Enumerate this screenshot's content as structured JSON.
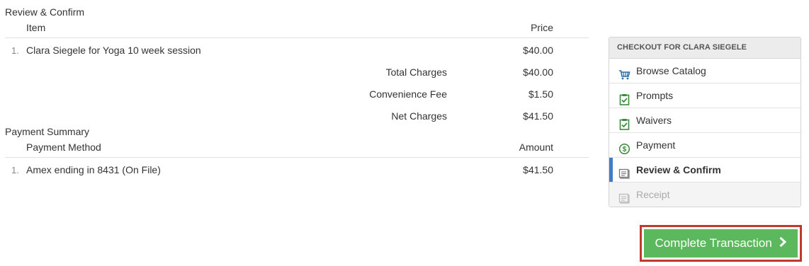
{
  "review": {
    "title": "Review & Confirm",
    "col_item": "Item",
    "col_price": "Price",
    "items": [
      {
        "num": "1.",
        "desc": "Clara Siegele for Yoga 10 week session",
        "price": "$40.00"
      }
    ],
    "totals": [
      {
        "label": "Total Charges",
        "value": "$40.00"
      },
      {
        "label": "Convenience Fee",
        "value": "$1.50"
      },
      {
        "label": "Net Charges",
        "value": "$41.50"
      }
    ]
  },
  "payment": {
    "title": "Payment Summary",
    "col_method": "Payment Method",
    "col_amount": "Amount",
    "items": [
      {
        "num": "1.",
        "desc": "Amex ending in 8431 (On File)",
        "amount": "$41.50"
      }
    ]
  },
  "sidebar": {
    "header": "CHECKOUT FOR CLARA SIEGELE",
    "items": [
      {
        "label": "Browse Catalog",
        "icon": "cart-icon"
      },
      {
        "label": "Prompts",
        "icon": "clipboard-check-icon"
      },
      {
        "label": "Waivers",
        "icon": "clipboard-check-icon"
      },
      {
        "label": "Payment",
        "icon": "dollar-circle-icon"
      },
      {
        "label": "Review & Confirm",
        "icon": "receipt-icon"
      },
      {
        "label": "Receipt",
        "icon": "receipt-icon"
      }
    ]
  },
  "actions": {
    "complete_label": "Complete Transaction"
  },
  "colors": {
    "primary_button": "#5cb85c",
    "active_indicator": "#3f7ec6",
    "highlight_border": "#c0392b",
    "icon_green": "#3c8a3c",
    "icon_blue": "#2e6da4"
  }
}
